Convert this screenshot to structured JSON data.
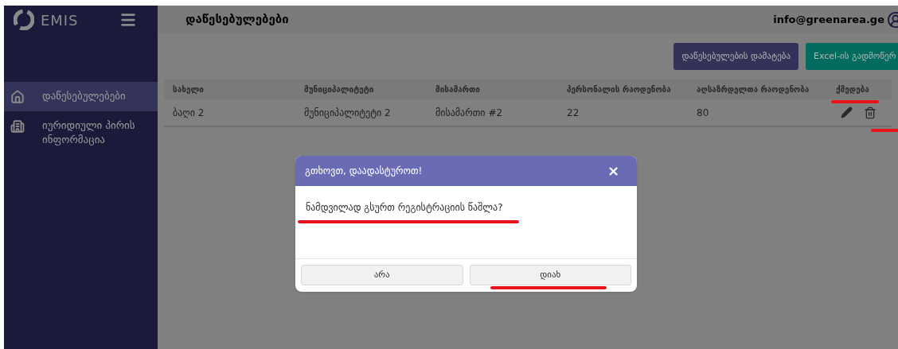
{
  "sidebar": {
    "logo": "EMIS",
    "items": [
      {
        "label": "დაწესებულებები",
        "kind": "home",
        "selected": true
      },
      {
        "label": "იურიდიული პირის ინფორმაცია",
        "kind": "building",
        "selected": false
      }
    ]
  },
  "header": {
    "title": "დაწესებულებები",
    "user": "info@greenarea.ge"
  },
  "toolbar": {
    "buttons": [
      {
        "label": "დაწესებულების დამატება",
        "kind": "primary"
      },
      {
        "label": "Excel-ის გადმოწერ",
        "kind": "excel"
      }
    ]
  },
  "table": {
    "columns": [
      "სახელი",
      "მუნიციპალიტეტი",
      "მისამართი",
      "პერსონალის რაოდენობა",
      "აღსაზრდელთა რაოდენობა",
      "ქმედება"
    ],
    "rows": [
      {
        "cells": [
          "ბაღი 2",
          "მუნიციპალიტეტი 2",
          "მისამართი #2",
          "22",
          "80"
        ]
      }
    ]
  },
  "dialog": {
    "title": "გთხოვთ, დაადასტუროთ!",
    "close": "×",
    "message": "ნამდვილად გსურთ რეგისტრაციის წაშლა?",
    "buttons": [
      "არა",
      "დიახ"
    ]
  }
}
